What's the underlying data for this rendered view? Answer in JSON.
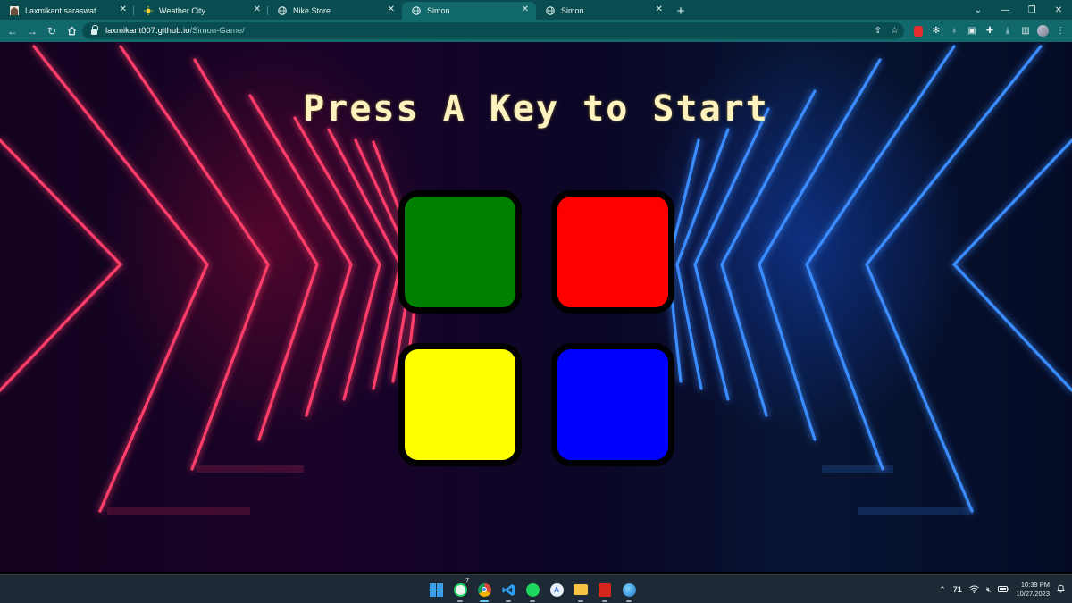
{
  "tabs": [
    {
      "title": "Laxmikant saraswat",
      "icon": "profile-favicon-icon",
      "active": false
    },
    {
      "title": "Weather City",
      "icon": "sun-favicon-icon",
      "active": false
    },
    {
      "title": "Nike Store",
      "icon": "globe-favicon-icon",
      "active": false
    },
    {
      "title": "Simon",
      "icon": "globe-favicon-icon",
      "active": true
    },
    {
      "title": "Simon",
      "icon": "globe-favicon-icon",
      "active": false
    }
  ],
  "address_bar": {
    "domain": "laxmikant007.github.io",
    "path": "/Simon-Game/"
  },
  "game": {
    "title": "Press A Key to Start",
    "buttons": [
      {
        "id": "green",
        "color": "#008000"
      },
      {
        "id": "red",
        "color": "#ff0000"
      },
      {
        "id": "yellow",
        "color": "#ffff00"
      },
      {
        "id": "blue",
        "color": "#0000ff"
      }
    ]
  },
  "taskbar": {
    "apps": [
      "windows-start-icon",
      "whatsapp-icon",
      "chrome-icon",
      "vscode-icon",
      "spotify-icon",
      "app-store-icon",
      "file-explorer-icon",
      "pdf-reader-icon",
      "browser-globe-icon"
    ],
    "whatsapp_badge": "7",
    "temperature": "71",
    "time": "10:39 PM",
    "date": "10/27/2023"
  },
  "colors": {
    "chrome_tabbar": "#0a4d50",
    "chrome_toolbar": "#12696c",
    "title": "#fef2bf",
    "neon_red": "#ff2a55",
    "neon_blue": "#2f8bff"
  }
}
